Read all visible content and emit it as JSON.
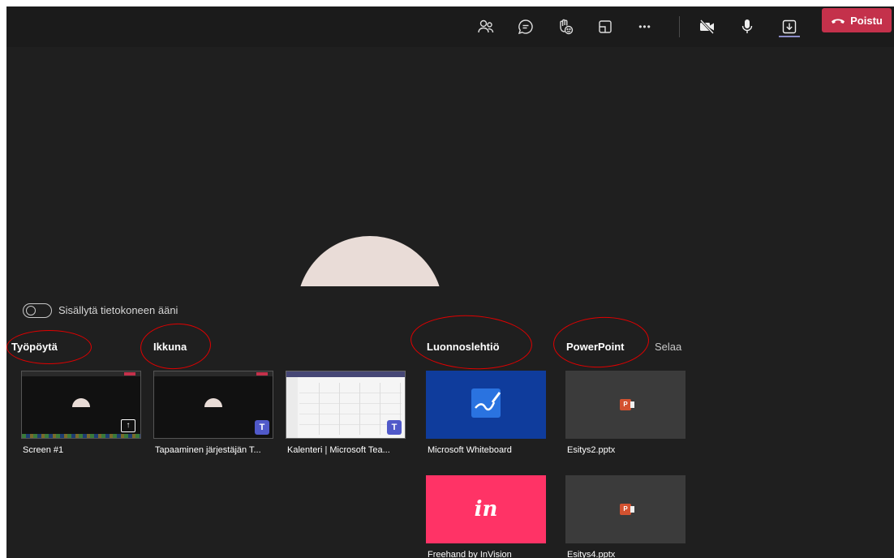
{
  "topbar": {
    "icons": [
      "participants-icon",
      "chat-icon",
      "raise-hand-icon",
      "rooms-icon",
      "more-icon",
      "camera-off-icon",
      "mic-icon",
      "share-tray-icon"
    ],
    "more_glyph": "•••",
    "leave_label": "Poistu",
    "leave_color": "#c4314b"
  },
  "tray": {
    "audio_toggle_label": "Sisällytä tietokoneen ääni",
    "categories": {
      "desktop": "Työpöytä",
      "window": "Ikkuna",
      "whiteboard": "Luonnoslehtiö",
      "powerpoint": "PowerPoint",
      "browse": "Selaa"
    },
    "items": {
      "screen1": "Screen #1",
      "window1": "Tapaaminen järjestäjän T...",
      "window2": "Kalenteri | Microsoft Tea...",
      "whiteboard": "Microsoft Whiteboard",
      "freehand": "Freehand by InVision",
      "ppt1": "Esitys2.pptx",
      "ppt2": "Esitys4.pptx"
    },
    "freehand_glyph": "in",
    "teams_badge": "T",
    "ppt_badge": "P"
  }
}
